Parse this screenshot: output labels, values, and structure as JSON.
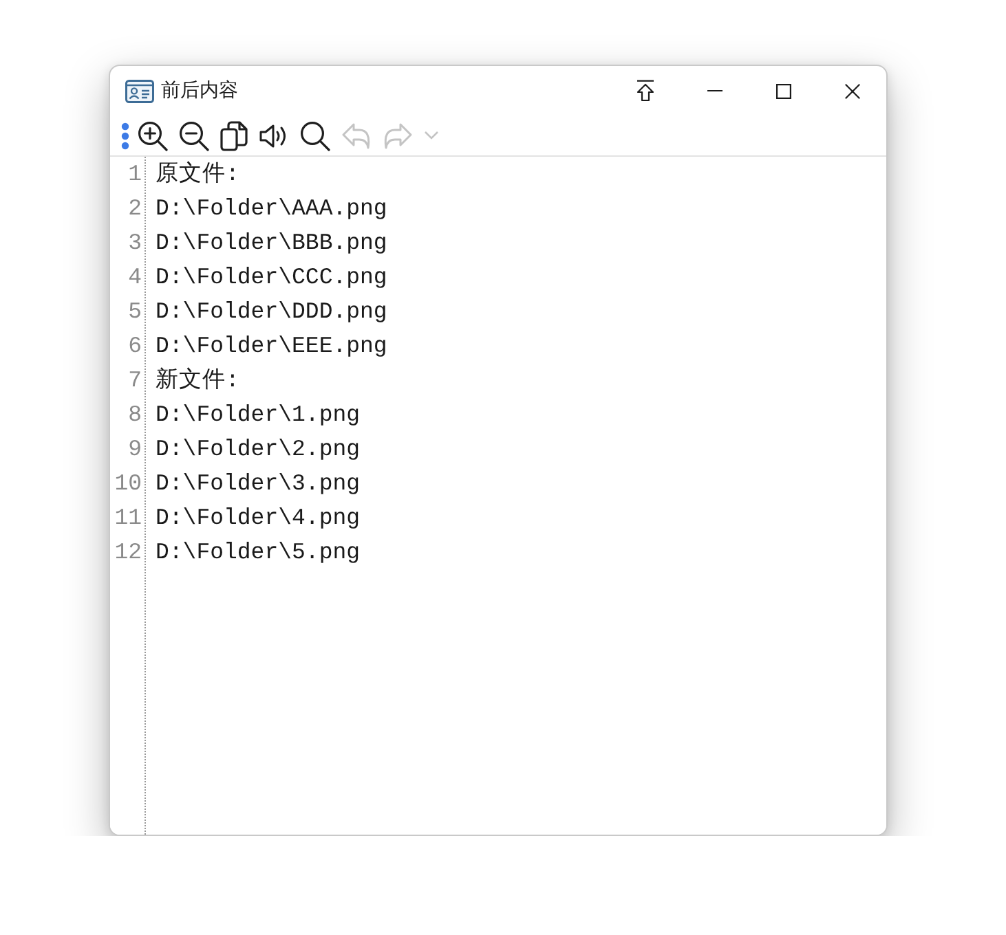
{
  "window": {
    "title": "前后内容"
  },
  "toolbar": [
    {
      "kind": "grip",
      "disabled": false
    },
    {
      "kind": "zoom-in",
      "disabled": false
    },
    {
      "kind": "zoom-out",
      "disabled": false
    },
    {
      "kind": "copy",
      "disabled": false
    },
    {
      "kind": "speaker",
      "disabled": false
    },
    {
      "kind": "search",
      "disabled": false
    },
    {
      "kind": "undo",
      "disabled": true
    },
    {
      "kind": "redo",
      "disabled": true
    },
    {
      "kind": "dropdown",
      "disabled": true
    }
  ],
  "editor": {
    "lines": [
      {
        "number": "1",
        "text": "原文件:"
      },
      {
        "number": "2",
        "text": "D:\\Folder\\AAA.png"
      },
      {
        "number": "3",
        "text": "D:\\Folder\\BBB.png"
      },
      {
        "number": "4",
        "text": "D:\\Folder\\CCC.png"
      },
      {
        "number": "5",
        "text": "D:\\Folder\\DDD.png"
      },
      {
        "number": "6",
        "text": "D:\\Folder\\EEE.png"
      },
      {
        "number": "7",
        "text": "新文件:"
      },
      {
        "number": "8",
        "text": "D:\\Folder\\1.png"
      },
      {
        "number": "9",
        "text": "D:\\Folder\\2.png"
      },
      {
        "number": "10",
        "text": "D:\\Folder\\3.png"
      },
      {
        "number": "11",
        "text": "D:\\Folder\\4.png"
      },
      {
        "number": "12",
        "text": "D:\\Folder\\5.png"
      }
    ]
  }
}
